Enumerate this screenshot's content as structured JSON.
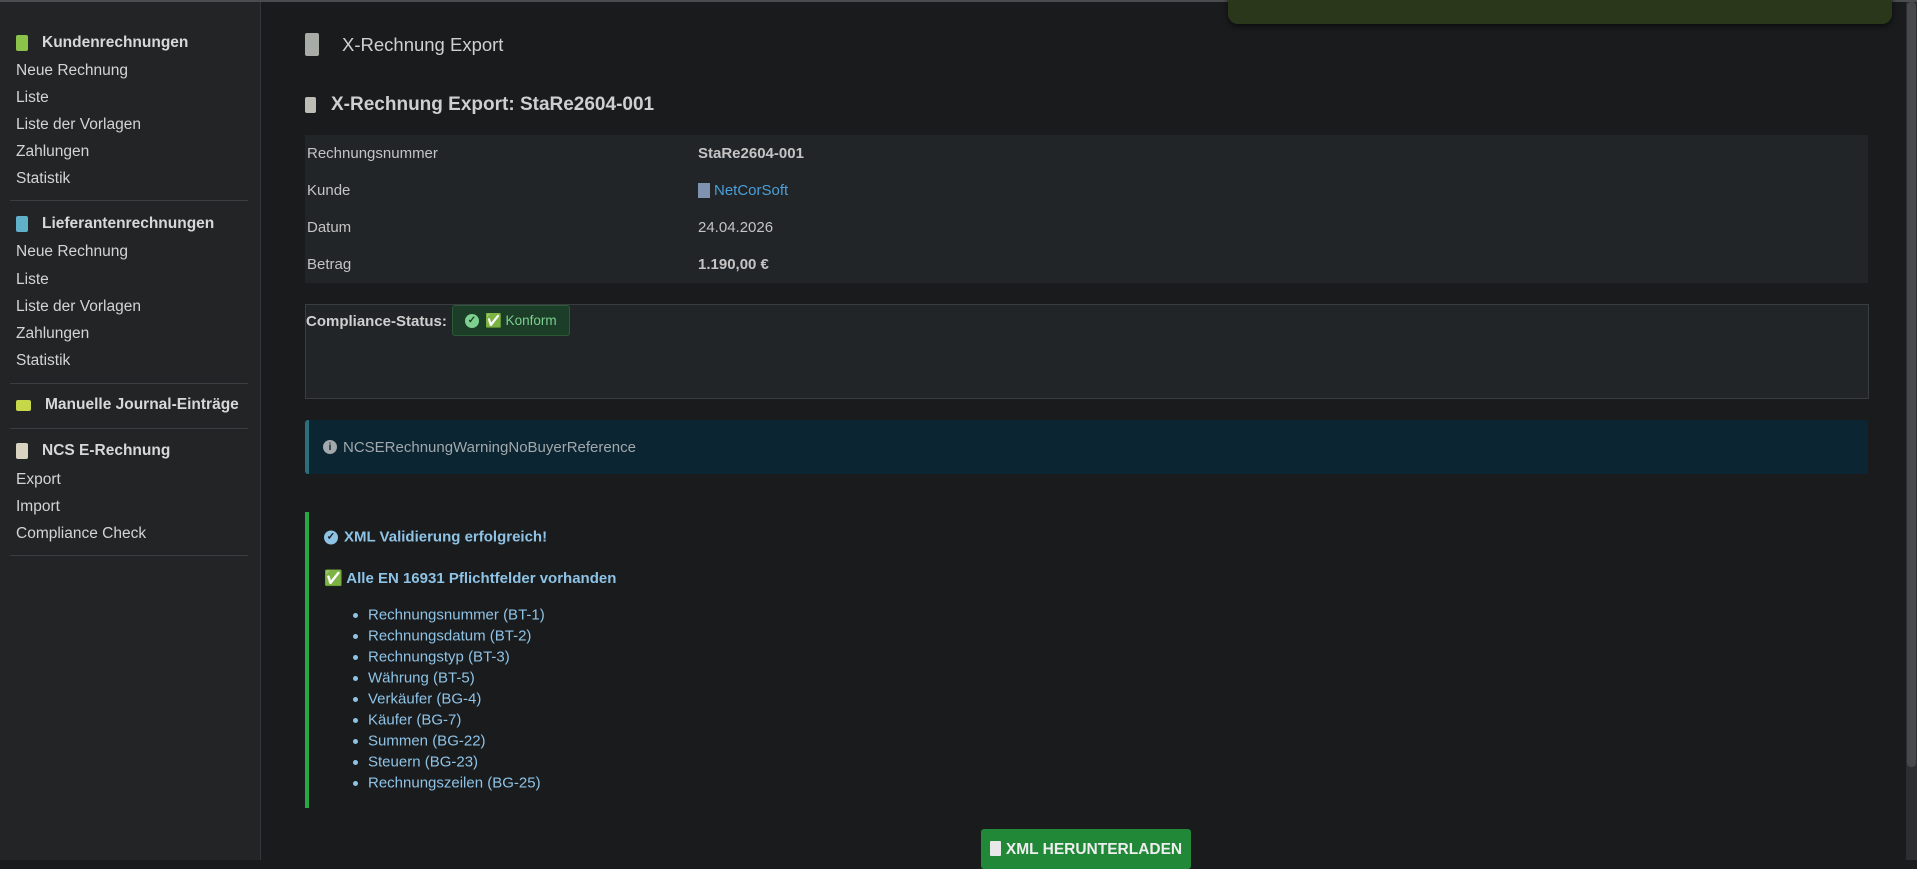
{
  "sidebar": {
    "sections": [
      {
        "title": "Kundenrechnungen",
        "icon": "invoice-dollar-icon",
        "color": "#8bc34a",
        "items": [
          "Neue Rechnung",
          "Liste",
          "Liste der Vorlagen",
          "Zahlungen",
          "Statistik"
        ]
      },
      {
        "title": "Lieferantenrechnungen",
        "icon": "invoice-dollar-icon",
        "color": "#5fb0c8",
        "items": [
          "Neue Rechnung",
          "Liste",
          "Liste der Vorlagen",
          "Zahlungen",
          "Statistik"
        ]
      },
      {
        "title": "Manuelle Journal-Einträge",
        "icon": "journal-icon",
        "color": "#c6d84a",
        "items": []
      },
      {
        "title": "NCS E-Rechnung",
        "icon": "file-text-icon",
        "color": "#d8d2c0",
        "items": [
          "Export",
          "Import",
          "Compliance Check"
        ]
      }
    ]
  },
  "page": {
    "title": "X-Rechnung Export",
    "heading": "X-Rechnung Export: StaRe2604-001"
  },
  "details": [
    {
      "label": "Rechnungsnummer",
      "value": "StaRe2604-001"
    },
    {
      "label": "Kunde",
      "value": "NetCorSoft"
    },
    {
      "label": "Datum",
      "value": "24.04.2026"
    },
    {
      "label": "Betrag",
      "value": "1.190,00 €"
    }
  ],
  "compliance": {
    "label": "Compliance-Status:",
    "badge": "✅ Konform"
  },
  "warning": "NCSERechnungWarningNoBuyerReference",
  "validation": {
    "title": "XML Validierung erfolgreich!",
    "subtitle": "✅ Alle EN 16931 Pflichtfelder vorhanden",
    "fields": [
      "Rechnungsnummer (BT-1)",
      "Rechnungsdatum (BT-2)",
      "Rechnungstyp (BT-3)",
      "Währung (BT-5)",
      "Verkäufer (BG-4)",
      "Käufer (BG-7)",
      "Summen (BG-22)",
      "Steuern (BG-23)",
      "Rechnungszeilen (BG-25)"
    ]
  },
  "download_button": "XML HERUNTERLADEN",
  "colors": {
    "success": "#28a745",
    "info_bg": "#0b2532",
    "link": "#4a9fd8"
  }
}
